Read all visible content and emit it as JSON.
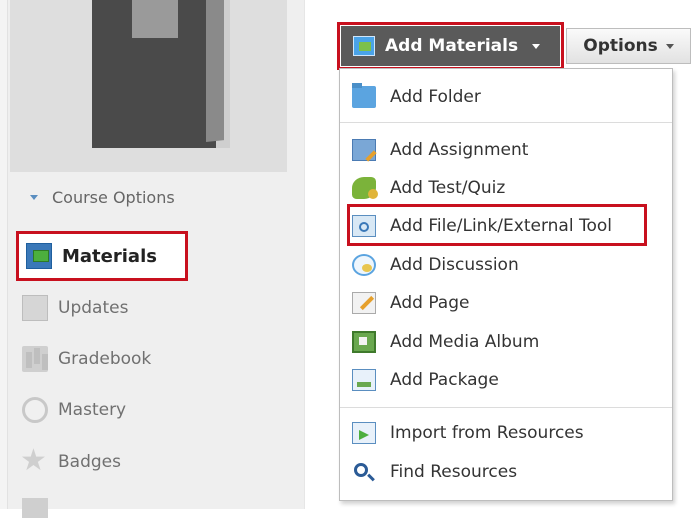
{
  "sidebar": {
    "course_options_label": "Course Options",
    "materials_label": "Materials",
    "items": [
      {
        "label": "Updates",
        "icon": "updates-icon"
      },
      {
        "label": "Gradebook",
        "icon": "gradebook-icon"
      },
      {
        "label": "Mastery",
        "icon": "mastery-icon"
      },
      {
        "label": "Badges",
        "icon": "badges-icon"
      }
    ]
  },
  "toolbar": {
    "add_materials_label": "Add Materials",
    "options_label": "Options"
  },
  "add_menu": {
    "items": [
      {
        "label": "Add Folder",
        "icon": "folder-icon"
      },
      {
        "label": "Add Assignment",
        "icon": "assignment-icon"
      },
      {
        "label": "Add Test/Quiz",
        "icon": "test-quiz-icon"
      },
      {
        "label": "Add File/Link/External Tool",
        "icon": "file-link-icon"
      },
      {
        "label": "Add Discussion",
        "icon": "discussion-icon"
      },
      {
        "label": "Add Page",
        "icon": "page-icon"
      },
      {
        "label": "Add Media Album",
        "icon": "media-album-icon"
      },
      {
        "label": "Add Package",
        "icon": "package-icon"
      },
      {
        "label": "Import from Resources",
        "icon": "import-icon"
      },
      {
        "label": "Find Resources",
        "icon": "find-resources-icon"
      }
    ],
    "highlighted_item": "Add File/Link/External Tool"
  },
  "colors": {
    "highlight_red": "#c8101e",
    "button_dark": "#5a5a5a"
  }
}
